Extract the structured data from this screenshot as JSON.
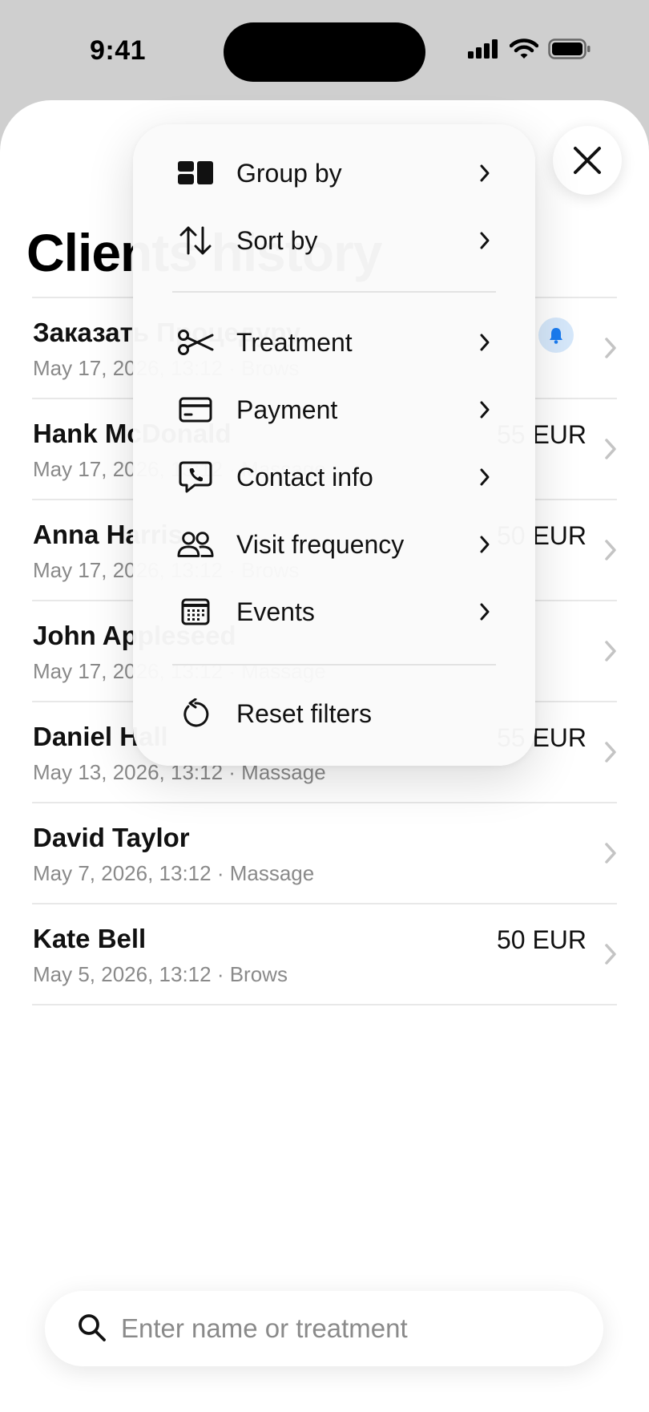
{
  "status": {
    "time": "9:41"
  },
  "page": {
    "title": "Clients history"
  },
  "clients": [
    {
      "name": "Заказать Процедуру",
      "meta": "May 17, 2026, 13:12 · Brows",
      "amount": "",
      "bell": true
    },
    {
      "name": "Hank McDonald",
      "meta": "May 17, 2026, 13:12 · Massage",
      "amount": "55 EUR",
      "bell": false
    },
    {
      "name": "Anna Harris",
      "meta": "May 17, 2026, 13:12 · Brows",
      "amount": "50 EUR",
      "bell": false
    },
    {
      "name": "John Appleseed",
      "meta": "May 17, 2026, 13:12 · Massage",
      "amount": "",
      "bell": false
    },
    {
      "name": "Daniel Hall",
      "meta": "May 13, 2026, 13:12 · Massage",
      "amount": "55 EUR",
      "bell": false
    },
    {
      "name": "David Taylor",
      "meta": "May 7, 2026, 13:12 · Massage",
      "amount": "",
      "bell": false
    },
    {
      "name": "Kate Bell",
      "meta": "May 5, 2026, 13:12 · Brows",
      "amount": "50 EUR",
      "bell": false
    }
  ],
  "menu": {
    "group_by": "Group by",
    "sort_by": "Sort by",
    "treatment": "Treatment",
    "payment": "Payment",
    "contact_info": "Contact info",
    "visit_frequency": "Visit frequency",
    "events": "Events",
    "reset_filters": "Reset filters"
  },
  "search": {
    "placeholder": "Enter name or treatment",
    "value": ""
  },
  "colors": {
    "accent": "#1a7cf0",
    "bell_bg": "#d6e8fb",
    "secondary_text": "#8a8a8a"
  }
}
